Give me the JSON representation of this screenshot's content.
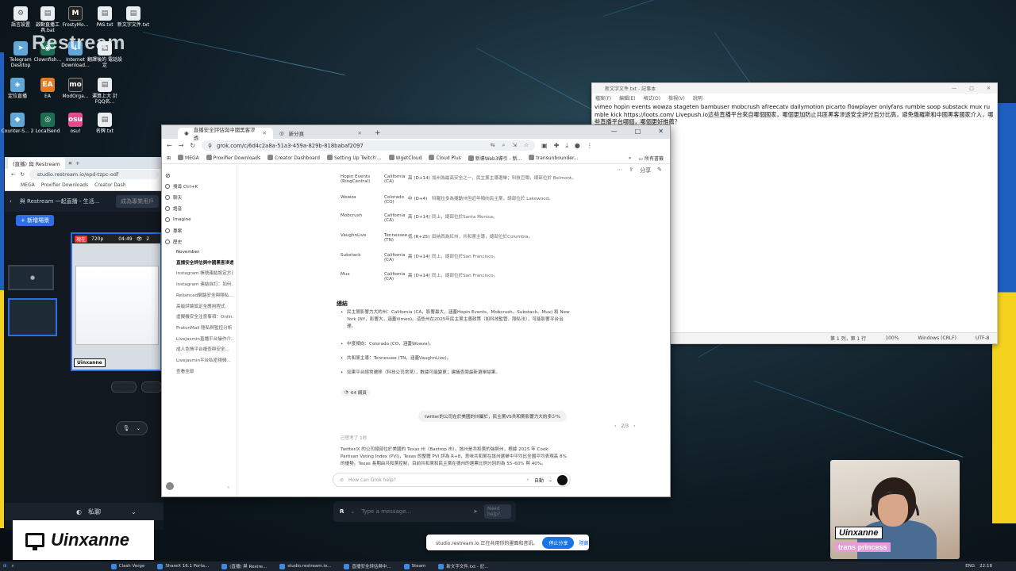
{
  "desktop": {
    "brand": "Restream",
    "icons": [
      {
        "label": "語言設置",
        "glyph": "⚙"
      },
      {
        "label": "啟動直播工具.bat",
        "glyph": "▤"
      },
      {
        "label": "FrostyMo...",
        "glyph": "M"
      },
      {
        "label": "PAS.txt",
        "glyph": "▤"
      },
      {
        "label": "新文字文件.txt",
        "glyph": "▤"
      },
      {
        "label": "Telegram Desktop",
        "glyph": "➤"
      },
      {
        "label": "Clownfish...",
        "glyph": "◉"
      },
      {
        "label": "Internet Download...",
        "glyph": "↓"
      },
      {
        "label": "翻譯後的 電話設定",
        "glyph": "▤"
      },
      {
        "label": "定位直播",
        "glyph": "◈"
      },
      {
        "label": "EA",
        "glyph": "EA"
      },
      {
        "label": "ModOrga...",
        "glyph": "mo"
      },
      {
        "label": "運算上大 計FQQ名...",
        "glyph": "▤"
      },
      {
        "label": "Counter-S... 2",
        "glyph": "◆"
      },
      {
        "label": "LocalSend",
        "glyph": "◎"
      },
      {
        "label": "osu!",
        "glyph": "osu"
      },
      {
        "label": "名牌.txt",
        "glyph": "▤"
      }
    ]
  },
  "studio": {
    "tab_label": "(直播) 與 Restream",
    "url": "studio.restream.io/epd-tzpc-odf",
    "bookmarks": [
      "MEGA",
      "Proxifier Downloads",
      "Creator Dash"
    ],
    "header_title": "與 Restream 一起直播 - 生活...",
    "header_action": "成為專業用戶",
    "new_scene_button": "+ 新增場景",
    "preview_time": "04:49",
    "preview_viewers": "2",
    "preview_badge": "現在",
    "preview_res": "720p",
    "preview_brand": "Uinxanne",
    "private_label": "私聊",
    "chat_placeholder": "Type a message...",
    "need_help": "Need help?"
  },
  "notepad": {
    "title": "新文字文件.txt - 記事本",
    "menu": [
      "檔案(F)",
      "編輯(E)",
      "格式(O)",
      "檢視(V)",
      "說明"
    ],
    "content": "vimeo hopin events wowza stageten bambuser mobcrush afreecatv dailymotion picarto flowplayer onlyfans rumble soop substack mux rumble kick https://loots.com/ Livepush.io這些直播平台來自哪個國家，哪個更加防止共匪黑客滲透安全評分百分比高，避免俄羅斯和中國黑客國家介入，哪些直播平台哪個，哪個更好推薦？",
    "status_pos": "第 1 列，第 1 行",
    "status_zoom": "100%",
    "status_eol": "Windows (CRLF)",
    "status_enc": "UTF-8"
  },
  "chrome": {
    "tabs": [
      {
        "label": "直播安全評估與中國黑客滲透"
      },
      {
        "label": "新分頁"
      }
    ],
    "new_tab": "+",
    "url": "grok.com/c/6d4c2a8a-51a3-459a-829b-818babaf2097",
    "bookmarks": [
      "MEGA",
      "Proxifier Downloads",
      "Creator Dashboard",
      "Setting Up Twitch'...",
      "WgetCloud",
      "Cloud Plus",
      "新導Web3導引 - 新...",
      "transunbounder..."
    ],
    "all_bookmarks": "所有書籤"
  },
  "grok": {
    "sidebar": {
      "search": "搜尋 Ctrl+K",
      "nav": [
        "聊天",
        "語音",
        "Imagine",
        "專案",
        "歷史"
      ],
      "history_header": "November",
      "history": [
        "直播安全評估與中國黑客滲透",
        "Instagram 帳號連結設定方法",
        "Instagram 連結自訂：如何...",
        "Relianced網路安全與隱私...",
        "高級評論設定全應用程式",
        "虛擬機安全注意事項：Onlin...",
        "ProtonMail 隱私與監控分析",
        "Livejasmin直播平台操作介...",
        "成人色情平台複查與安全...",
        "Livejasmin平台私密視頻...",
        "查看全部"
      ]
    },
    "share": "分享",
    "table_rows": [
      {
        "name": "Hopin Events (RingCentral)",
        "state": "California (CA)",
        "score": "高 (D+14)",
        "note": "加州為最高安全之一，民主黨主導選舉；科技巨頭，總部位於 Belmont。"
      },
      {
        "name": "Wowza",
        "state": "Colorado (CO)",
        "score": "中 (D+4)",
        "note": "科羅拉多為擺動州但近年傾向民主黨，總部位於 Lakewood。"
      },
      {
        "name": "Mobcrush",
        "state": "California (CA)",
        "score": "高 (D+14)",
        "note": "同上，總部位於Santa Monica。"
      },
      {
        "name": "VaughnLive",
        "state": "Tennessee (TN)",
        "score": "低 (R+25)",
        "note": "田納西為紅州，共和黨主導，總部位於Columbia。"
      },
      {
        "name": "Substack",
        "state": "California (CA)",
        "score": "高 (D+14)",
        "note": "同上，總部位於San Francisco。"
      },
      {
        "name": "Mux",
        "state": "California (CA)",
        "score": "高 (D+14)",
        "note": "同上，總部位於San Francisco。"
      }
    ],
    "summary_title": "總結",
    "summary_bullets": [
      "民主黨影響力大的州：California (CA，影響最大，涵蓋Hopin Events、Mobcrush、Substack、Mux) 和 New York (NY，影響大，涵蓋Vimeo)。這些州在2025年民主黨主導政策（如科技監管、隱私法），可能影響平台治理。",
      "中度傾向：Colorado (CO，涵蓋Wowza)。",
      "共和黨主導：Tennessee (TN，涵蓋VaughnLive)。",
      "如果平台經常遷移（科技公司常見），數據可能變更；建議查閱最新選舉結果。"
    ],
    "sources_label": "64 網頁",
    "user_prompt": "twitter的公司在於美國的州屬於，民主黨VS共和黨影響力大約多少%",
    "pager": "2/3",
    "thinking": "已思考了 1秒",
    "answer_text": "Twitter/X 的公司總部位於美國的 Texas 州（Bastrop 市）。該州是共和黨的強勢州，根據 2025 年 Cook Partisan Voting Index (PVI)，Texas 的整體 PVI 評為 R+8，意味共和黨在該州選舉中平均比全國平均表現高 8% 的優勢。Texas 長期由共和黨控制，目前共和黨和民主黨在德州的選票比例分別約為 55–60% 與 40%。",
    "input_placeholder": "How can Grok help?",
    "mode_label": "自動"
  },
  "share_bar": {
    "text": "studio.restream.io 正在共用你的畫面和音訊。",
    "stop": "停止分享",
    "hide": "隱藏"
  },
  "webcam": {
    "name": "Uinxanne",
    "tag": "trans princess"
  },
  "logo": {
    "text": "Uinxanne"
  },
  "taskbar": {
    "items": [
      "Clash Verge",
      "ShareX 16.1 Porta...",
      "(直播) 與 Restre...",
      "studio.restream.io...",
      "直播安全評估與中...",
      "Steam",
      "新文字文件.txt - 記..."
    ],
    "lang": "ENG",
    "time": "22:18"
  }
}
